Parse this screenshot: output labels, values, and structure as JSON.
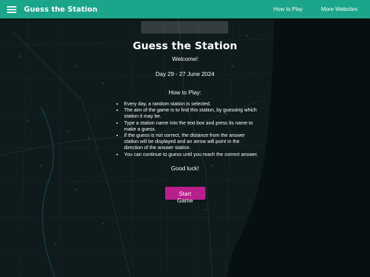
{
  "app_bar": {
    "title": "Guess the Station",
    "nav": [
      {
        "label": "How to Play"
      },
      {
        "label": "More Websites"
      }
    ],
    "color": "#1ba58a"
  },
  "dialog": {
    "title": "Guess the Station",
    "welcome": "Welcome!",
    "day": "Day 29 - 27 June 2024",
    "how_to_heading": "How to Play:",
    "rules": [
      "Every day, a random station is selected.",
      "The aim of the game is to find this station, by guessing which station it may be.",
      "Type a station name into the text box and press its name to make a guess.",
      "If the guess is not correct, the distance from the answer station will be displayed and an arrow will point in the direction of the answer station.",
      "You can continue to guess until you reach the correct answer."
    ],
    "good_luck": "Good luck!",
    "start_button": "Start Game",
    "button_color": "#b81f8a"
  }
}
